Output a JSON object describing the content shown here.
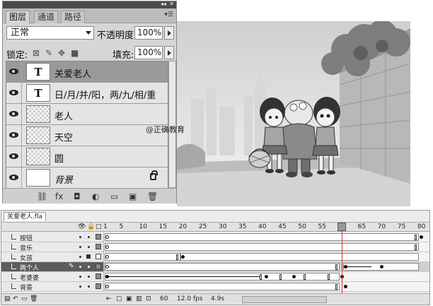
{
  "layers_panel": {
    "tabs": [
      "图层",
      "通道",
      "路径"
    ],
    "active_tab": 0,
    "blend_mode": "正常",
    "opacity_label": "不透明度:",
    "opacity_value": "100%",
    "lock_label": "锁定:",
    "fill_label": "填充:",
    "fill_value": "100%",
    "layers": [
      {
        "name": "关爱老人",
        "thumb": "text-warp",
        "selected": true,
        "italic": false
      },
      {
        "name": "日/月/并/阳，两/九/相/重",
        "thumb": "text",
        "selected": false,
        "italic": false
      },
      {
        "name": "老人",
        "thumb": "transparent",
        "selected": false,
        "italic": false
      },
      {
        "name": "天空",
        "thumb": "transparent",
        "selected": false,
        "italic": false
      },
      {
        "name": "圆",
        "thumb": "transparent",
        "selected": false,
        "italic": false
      },
      {
        "name": "背景",
        "thumb": "white",
        "selected": false,
        "italic": true,
        "locked": true
      }
    ],
    "thumb_glyphs": {
      "text-warp": "T",
      "text": "T"
    },
    "bottom_icons": [
      "link-icon",
      "fx-icon",
      "mask-icon",
      "adjustment-icon",
      "group-icon",
      "new-layer-icon",
      "trash-icon"
    ],
    "bottom_glyphs": [
      "⛓",
      "fx",
      "◘",
      "◐",
      "▭",
      "▣",
      "🗑"
    ]
  },
  "watermark": "@正确教育",
  "timeline": {
    "tab_label": "关爱老人.fla",
    "ruler": [
      "1",
      "5",
      "10",
      "15",
      "20",
      "25",
      "30",
      "35",
      "40",
      "45",
      "50",
      "55",
      "60",
      "65",
      "70",
      "75",
      "80"
    ],
    "layers": [
      {
        "name": "按钮",
        "selected": false
      },
      {
        "name": "音乐",
        "selected": false
      },
      {
        "name": "女孩",
        "selected": false
      },
      {
        "name": "两个人",
        "selected": true
      },
      {
        "name": "老婆婆",
        "selected": false
      },
      {
        "name": "背景",
        "selected": false
      }
    ],
    "current_frame": "60",
    "frame_rate": "12.0 fps",
    "elapsed_time": "4.9s"
  }
}
